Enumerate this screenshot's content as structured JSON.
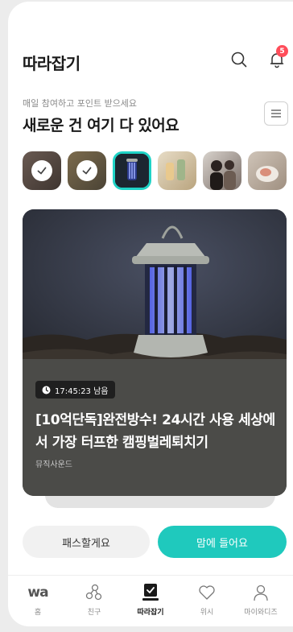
{
  "header": {
    "title": "따라잡기",
    "notification_count": "5"
  },
  "intro": {
    "caption": "매일 참여하고 포인트 받으세요",
    "headline": "새로운 건 여기 다 있어요"
  },
  "thumbnails": [
    {
      "name": "thumb-1",
      "state": "checked"
    },
    {
      "name": "thumb-2",
      "state": "checked"
    },
    {
      "name": "thumb-3",
      "state": "selected"
    },
    {
      "name": "thumb-4",
      "state": "normal"
    },
    {
      "name": "thumb-5",
      "state": "normal"
    },
    {
      "name": "thumb-6",
      "state": "normal"
    },
    {
      "name": "thumb-7",
      "state": "normal"
    }
  ],
  "card": {
    "timer": "17:45:23 남음",
    "title": "[10억단독]완전방수! 24시간 사용 세상에서 가장 터프한 캠핑벌레퇴치기",
    "brand": "뮤직사운드"
  },
  "actions": {
    "pass_label": "패스할게요",
    "like_label": "맘에 들어요"
  },
  "nav": {
    "items": [
      {
        "label": "홈",
        "icon": "wa-logo"
      },
      {
        "label": "친구",
        "icon": "friends-icon"
      },
      {
        "label": "따라잡기",
        "icon": "catchup-icon",
        "active": true
      },
      {
        "label": "위시",
        "icon": "heart-icon"
      },
      {
        "label": "마이와디즈",
        "icon": "person-icon"
      }
    ],
    "logo_text": "wa"
  },
  "colors": {
    "accent": "#1fc9bd",
    "badge": "#ff4d5a",
    "selected_border": "#1fd3c6"
  }
}
